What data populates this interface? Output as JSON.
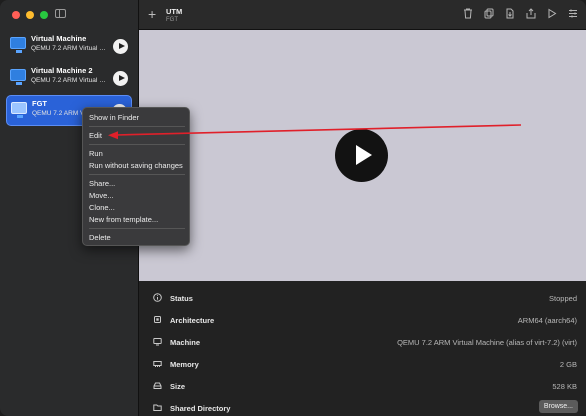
{
  "window": {
    "title": "UTM",
    "subtitle": "FGT"
  },
  "sidebar": {
    "vms": [
      {
        "name": "Virtual Machine",
        "subtitle": "QEMU 7.2 ARM Virtual M..."
      },
      {
        "name": "Virtual Machine 2",
        "subtitle": "QEMU 7.2 ARM Virtual M..."
      },
      {
        "name": "FGT",
        "subtitle": "QEMU 7.2 ARM Virtual M...",
        "selected": true
      }
    ]
  },
  "toolbar": {
    "icons": [
      "trash-icon",
      "clone-icon",
      "share-icon",
      "upload-icon",
      "play-icon",
      "settings-icon"
    ]
  },
  "context_menu": {
    "items": [
      "Show in Finder",
      "Edit",
      "Run",
      "Run without saving changes",
      "Share...",
      "Move...",
      "Clone...",
      "New from template...",
      "Delete"
    ]
  },
  "info": {
    "status_label": "Status",
    "status_value": "Stopped",
    "architecture_label": "Architecture",
    "architecture_value": "ARM64 (aarch64)",
    "machine_label": "Machine",
    "machine_value": "QEMU 7.2 ARM Virtual Machine (alias of virt-7.2) (virt)",
    "memory_label": "Memory",
    "memory_value": "2 GB",
    "size_label": "Size",
    "size_value": "528 KB",
    "shared_label": "Shared Directory",
    "browse_label": "Browse..."
  },
  "colors": {
    "accent": "#2a62d8",
    "annotation_arrow": "#e0202a",
    "display_bg": "#cac8d3"
  }
}
